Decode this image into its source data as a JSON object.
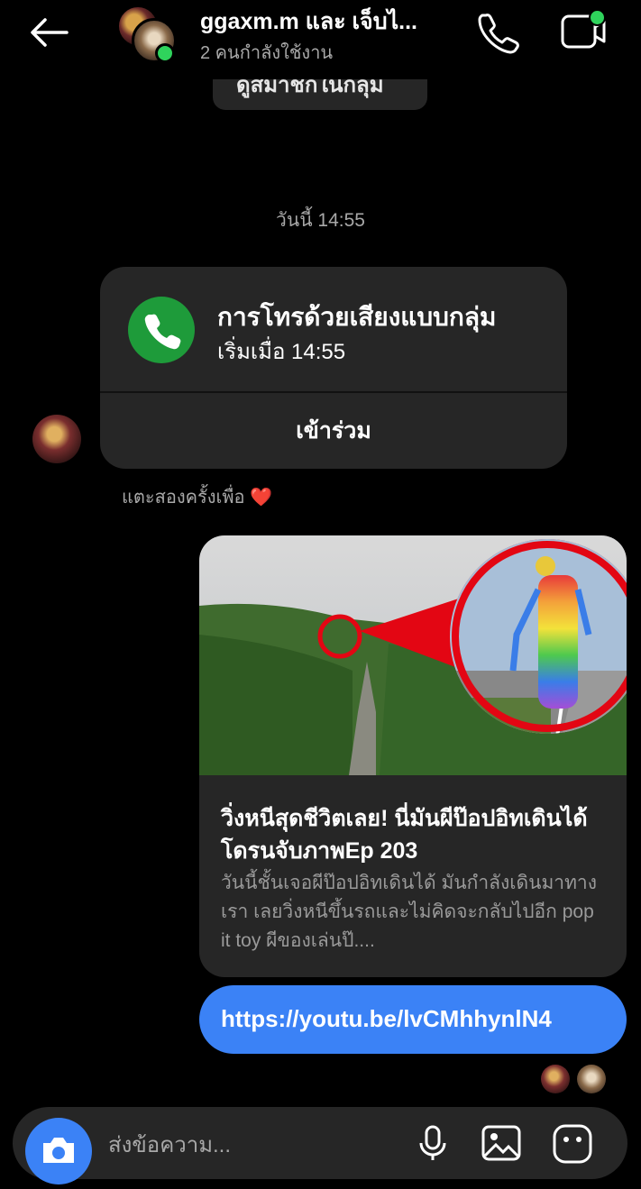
{
  "header": {
    "title": "ggaxm.m และ เจ็บไ...",
    "subtitle": "2 คนกำลังใช้งาน"
  },
  "system_pill": {
    "label": "ดูสมาชิกในกลุ่ม"
  },
  "thread": {
    "timestamp": "วันนี้ 14:55",
    "call_card": {
      "title": "การโทรด้วยเสียงแบบกลุ่ม",
      "subtitle": "เริ่มเมื่อ 14:55",
      "join_label": "เข้าร่วม"
    },
    "tap_hint": "แตะสองครั้งเพื่อ ❤️",
    "link_preview": {
      "title": "วิ่งหนีสุดชีวิตเลย! นี่มันผีป๊อปอิทเดินได้ โดรนจับภาพEp 203",
      "description": "วันนี้ชั้นเจอผีป๊อปอิทเดินได้ มันกำลังเดินมาทางเรา เลยวิ่งหนีขึ้นรถและไม่คิดจะกลับไปอีก pop it toy ผีของเล่นป๊...."
    },
    "url_message": "https://youtu.be/lvCMhhynlN4"
  },
  "composer": {
    "placeholder": "ส่งข้อความ..."
  },
  "icons": {
    "back": "arrow-left-icon",
    "call": "phone-icon",
    "video": "video-camera-icon",
    "camera": "camera-icon",
    "mic": "microphone-icon",
    "gallery": "image-icon",
    "sticker": "sticker-icon"
  },
  "colors": {
    "background": "#000000",
    "bubble_gray": "#262626",
    "accent_blue": "#3b82f6",
    "online_green": "#2fd35c",
    "call_green": "#1e9b3a",
    "highlight_red": "#e30613"
  }
}
